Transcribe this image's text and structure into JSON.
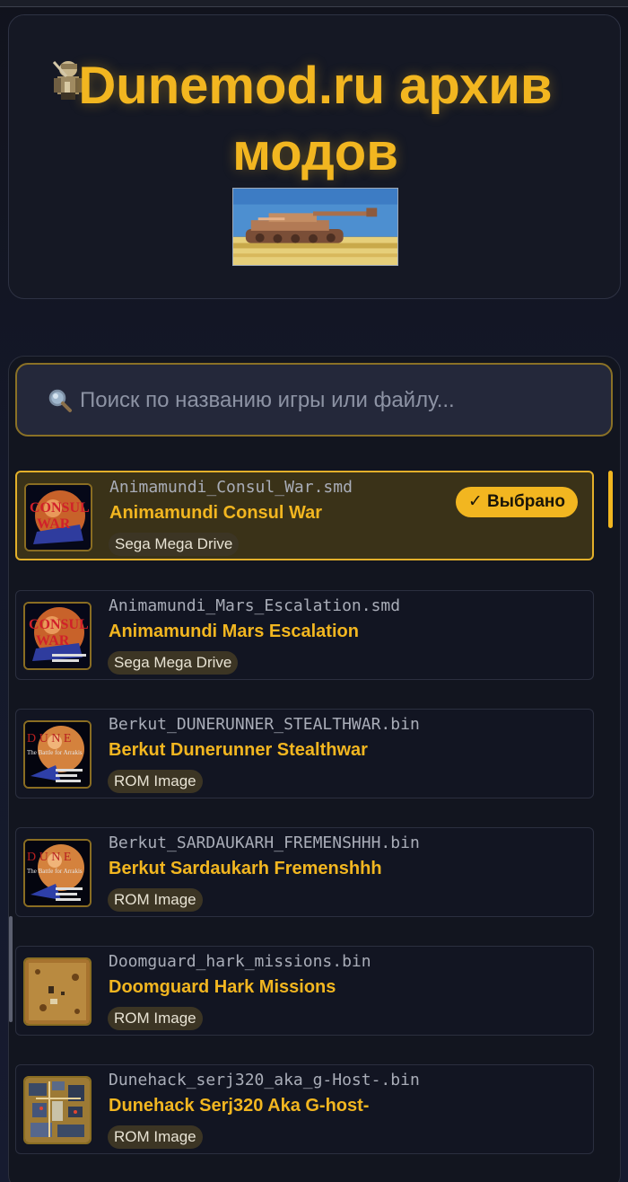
{
  "header": {
    "title": "Dunemod.ru архив модов"
  },
  "search": {
    "placeholder": "Поиск по названию игры или файлу..."
  },
  "items": [
    {
      "filename": "Animamundi_Consul_War.smd",
      "title": "Animamundi Consul War",
      "platform": "Sega Mega Drive",
      "selected": true,
      "badge": "✓ Выбрано"
    },
    {
      "filename": "Animamundi_Mars_Escalation.smd",
      "title": "Animamundi Mars Escalation",
      "platform": "Sega Mega Drive"
    },
    {
      "filename": "Berkut_DUNERUNNER_STEALTHWAR.bin",
      "title": "Berkut Dunerunner Stealthwar",
      "platform": "ROM Image"
    },
    {
      "filename": "Berkut_SARDAUKARH_FREMENSHHH.bin",
      "title": "Berkut Sardaukarh Fremenshhh",
      "platform": "ROM Image"
    },
    {
      "filename": "Doomguard_hark_missions.bin",
      "title": "Doomguard Hark Missions",
      "platform": "ROM Image"
    },
    {
      "filename": "Dunehack_serj320_aka_g-Host-.bin",
      "title": "Dunehack Serj320 Aka G-host-",
      "platform": "ROM Image"
    }
  ],
  "colors": {
    "accent": "#f2b620",
    "background": "#12151f"
  }
}
